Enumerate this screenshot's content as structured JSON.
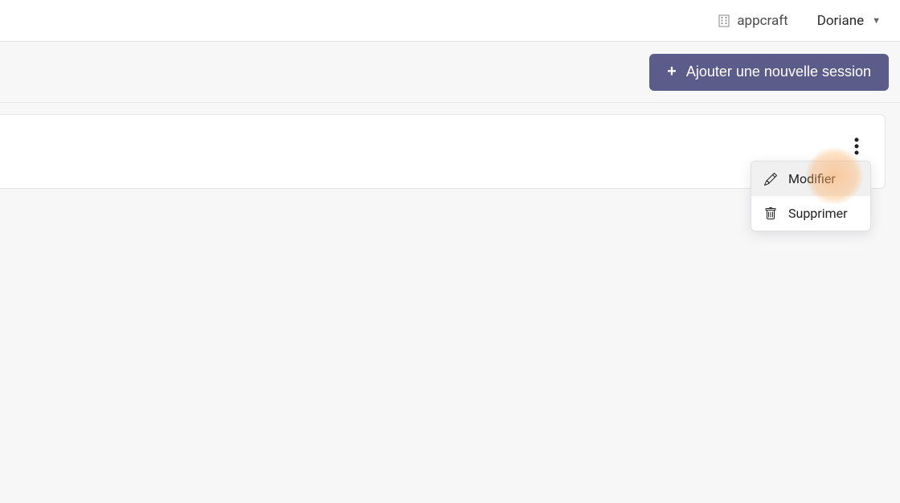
{
  "header": {
    "org_name": "appcraft",
    "user_name": "Doriane"
  },
  "action_bar": {
    "add_button_label": "Ajouter une nouvelle session"
  },
  "dropdown": {
    "items": [
      {
        "label": "Modifier",
        "icon": "edit"
      },
      {
        "label": "Supprimer",
        "icon": "trash"
      }
    ]
  }
}
